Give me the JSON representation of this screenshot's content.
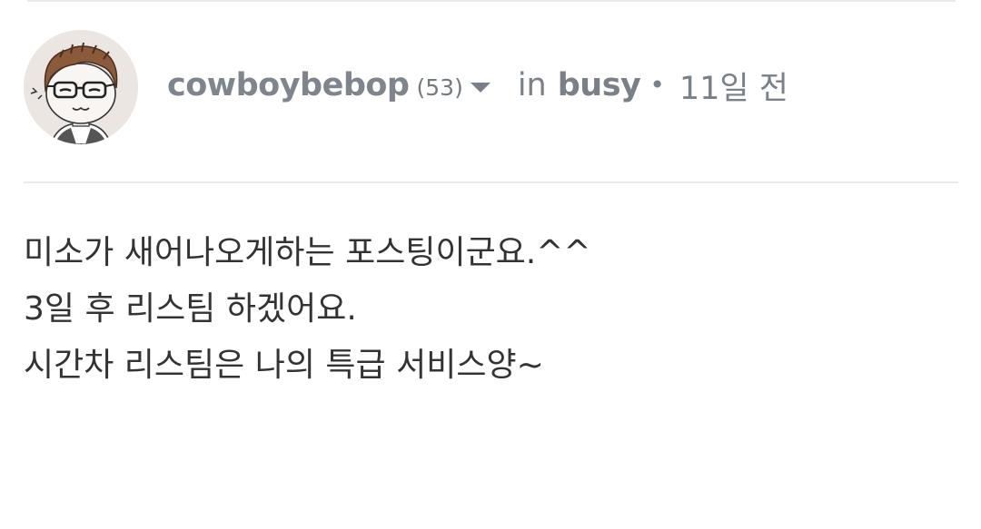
{
  "post": {
    "author": {
      "name": "cowboybebop",
      "reputation": "(53)",
      "avatar_icon": "avatar-caricature-icon"
    },
    "in_label": "in",
    "community": "busy",
    "separator": "•",
    "time_ago": "11일 전",
    "body_lines": [
      "미소가 새어나오게하는 포스팅이군요.^^",
      "3일 후 리스팀 하겠어요.",
      "시간차 리스팀은 나의 특급 서비스양~"
    ]
  },
  "colors": {
    "meta_text": "#7a8087",
    "body_text": "#333333",
    "divider": "#e9eaeb",
    "background": "#ffffff"
  }
}
